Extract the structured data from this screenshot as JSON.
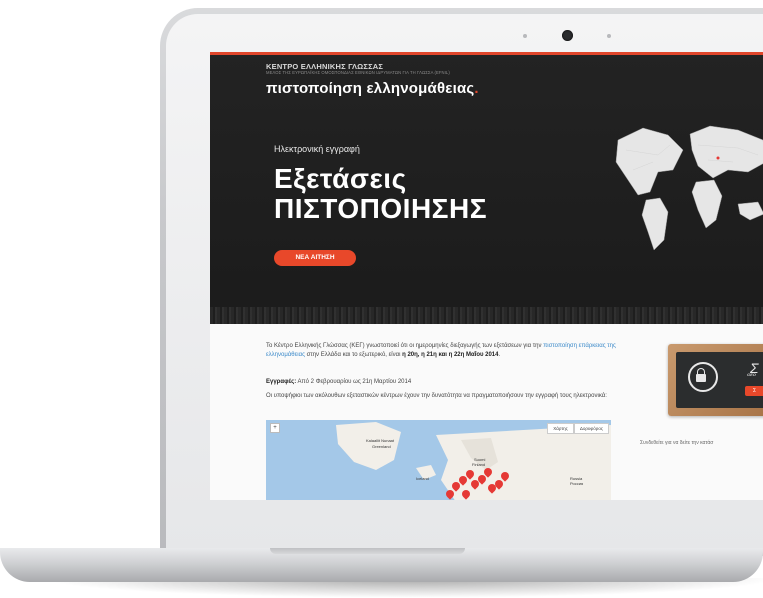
{
  "site": {
    "org_name": "ΚΕΝΤΡΟ ΕΛΛΗΝΙΚΗΣ ΓΛΩΣΣΑΣ",
    "org_subtitle": "ΜΕΛΟΣ ΤΗΣ ΕΥΡΩΠΑΪΚΗΣ ΟΜΟΣΠΟΝΔΙΑΣ ΕΘΝΙΚΩΝ ΙΔΡΥΜΑΤΩΝ ΓΙΑ ΤΗ ΓΛΩΣΣΑ (EFNIL)",
    "title": "πιστοποίηση ελληνομάθειας",
    "title_dot": "."
  },
  "hero": {
    "subtitle": "Ηλεκτρονική εγγραφή",
    "title_line1": "Εξετάσεις",
    "title_line2": "ΠΙΣΤΟΠΟΙΗΣΗΣ",
    "cta_label": "ΝΕΑ ΑΙΤΗΣΗ"
  },
  "content": {
    "intro_part1": "Το Κέντρο Ελληνικής Γλώσσας (ΚΕΓ) γνωστοποιεί ότι οι ημερομηνίες διεξαγωγής των εξετάσεων για την ",
    "intro_link": "πιστοποίηση επάρκειας της ελληνομάθειας",
    "intro_part2": " στην Ελλάδα και το εξωτερικό, είναι ",
    "intro_dates": "η 20η, η 21η και η 22η Μαΐου 2014",
    "intro_end": ".",
    "registrations_label": "Εγγραφές:",
    "registrations_text": " Από 2 Φεβρουαρίου ως 21η Μαρτίου 2014",
    "candidates_text": "Οι υποψήφιοι των ακόλουθων εξεταστικών κέντρων έχουν την δυνατότητα να πραγματοποιήσουν την εγγραφή τους ηλεκτρονικά:"
  },
  "map": {
    "btn_map": "Χάρτης",
    "btn_satellite": "Δορυφόρος",
    "zoom_label": "+",
    "labels": [
      "Kalaallit Nunaat",
      "Greenland",
      "Iceland",
      "Suomi",
      "Finland",
      "Russia",
      "Россия"
    ]
  },
  "sidebar": {
    "chalk_text": "Σ",
    "chalk_sub": "GEO",
    "caption": "Συνδεθείτε για να δείτε την κατάσ"
  },
  "colors": {
    "accent": "#e8482a",
    "hero_bg": "#1f1f1f",
    "link": "#3a89c9"
  }
}
